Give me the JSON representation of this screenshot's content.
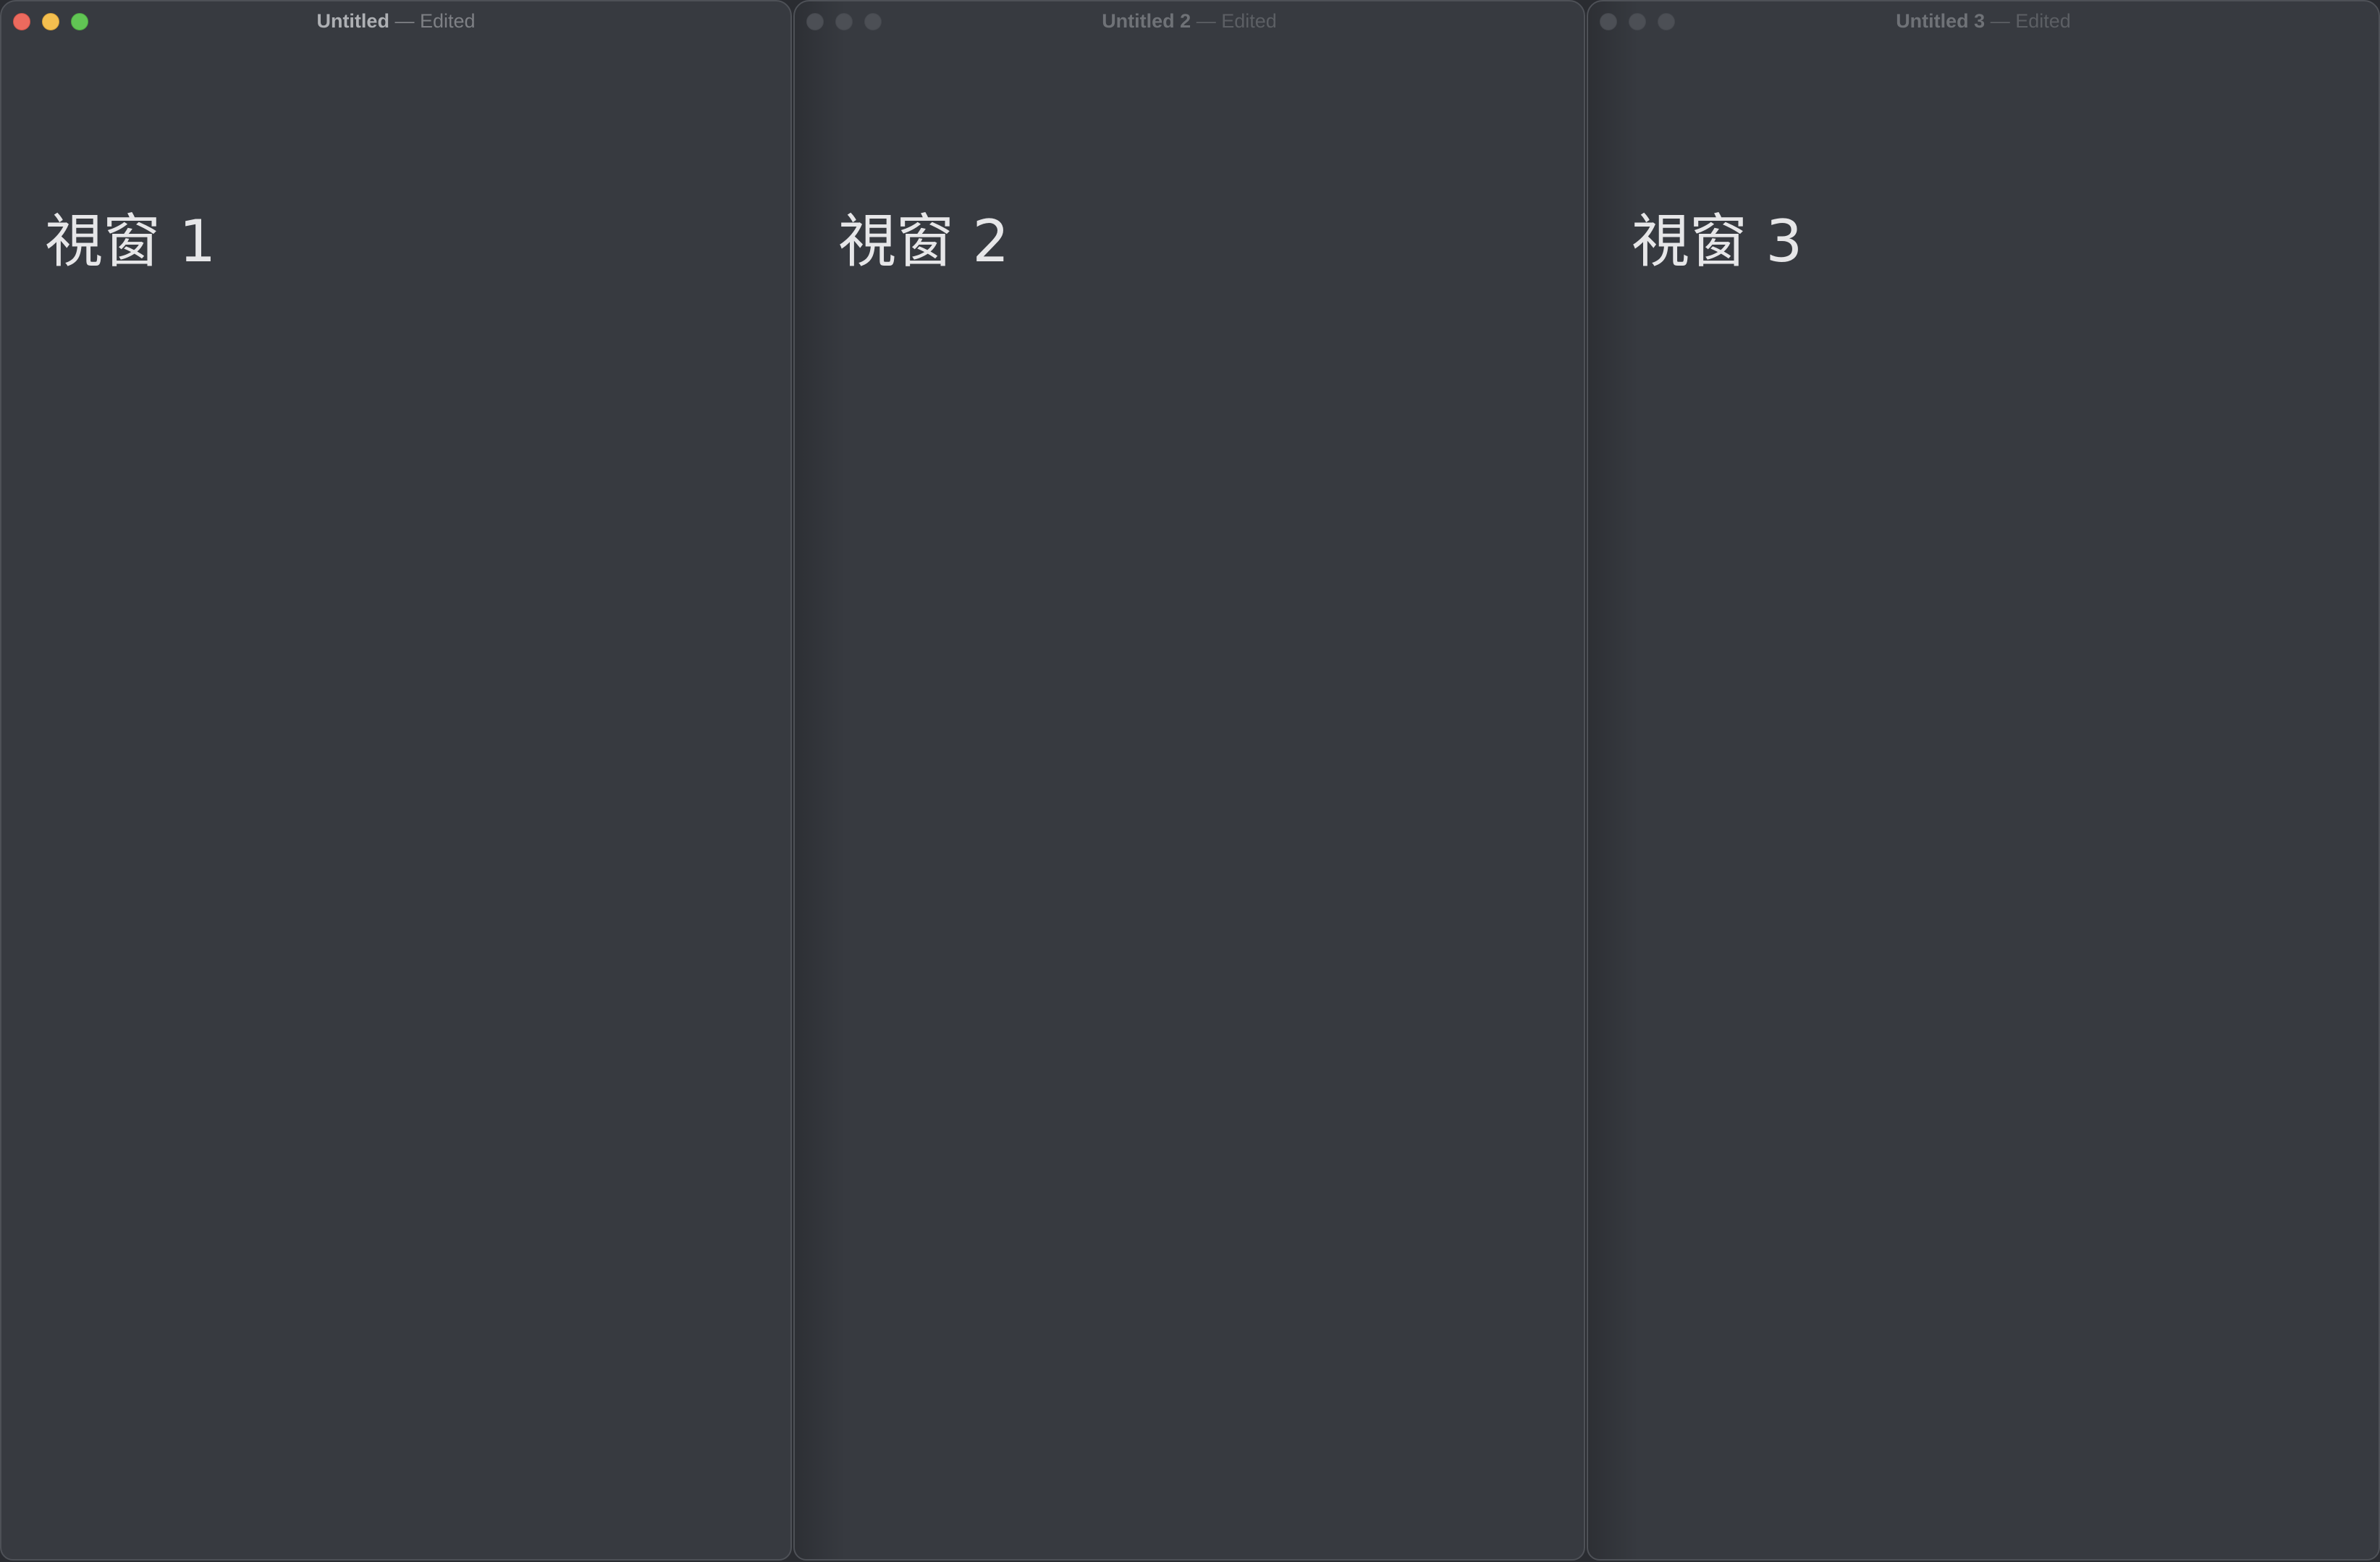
{
  "windows": [
    {
      "title": "Untitled",
      "separator": "—",
      "status": "Edited",
      "active": true,
      "content": "視窗 1"
    },
    {
      "title": "Untitled 2",
      "separator": "—",
      "status": "Edited",
      "active": false,
      "content": "視窗 2"
    },
    {
      "title": "Untitled 3",
      "separator": "—",
      "status": "Edited",
      "active": false,
      "content": "視窗 3"
    }
  ],
  "colors": {
    "window_background": "#373a40",
    "close": "#ec6a5e",
    "minimize": "#f4bf4f",
    "zoom": "#61c554",
    "inactive_light": "#4c4f55"
  }
}
